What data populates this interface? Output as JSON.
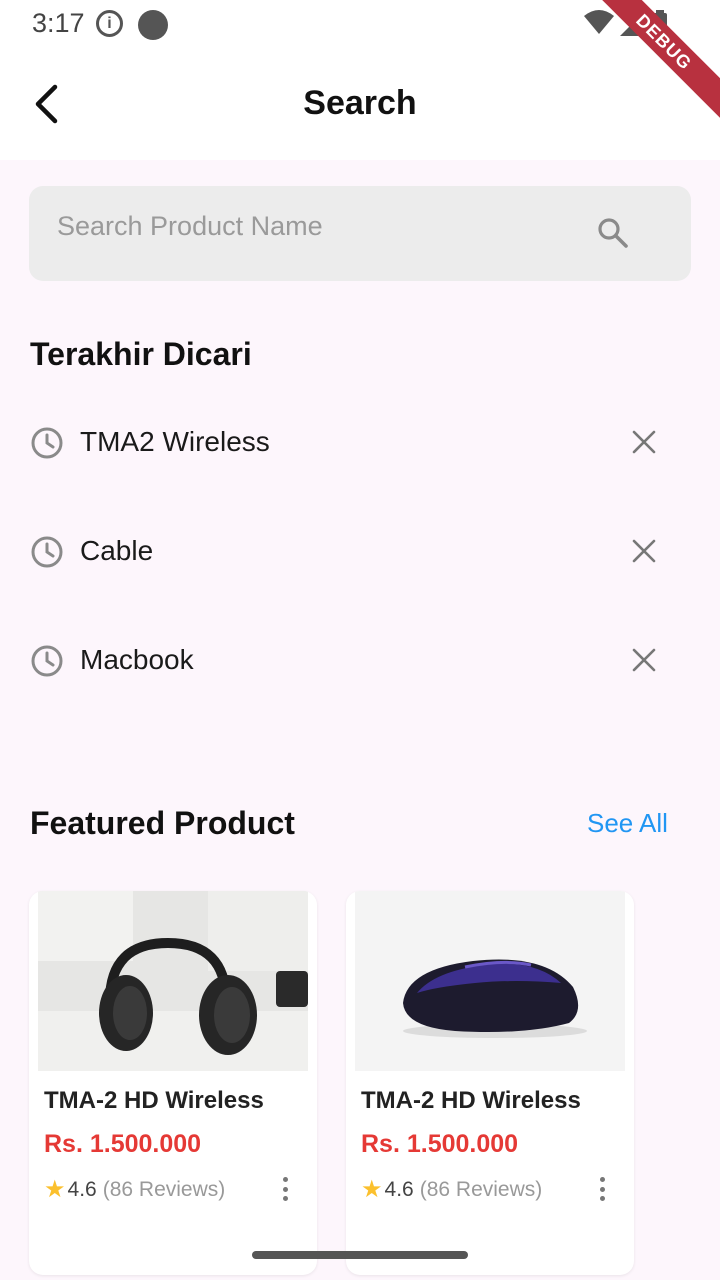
{
  "status_bar": {
    "time": "3:17",
    "info_glyph": "i"
  },
  "debug_banner": "DEBUG",
  "app_bar": {
    "title": "Search",
    "back_icon": "chevron-left-icon"
  },
  "search": {
    "placeholder": "Search Product Name",
    "value": "",
    "icon": "search-icon"
  },
  "recent": {
    "title": "Terakhir Dicari",
    "items": [
      {
        "label": "TMA2 Wireless"
      },
      {
        "label": "Cable"
      },
      {
        "label": "Macbook"
      }
    ]
  },
  "featured": {
    "title": "Featured Product",
    "see_all": "See All",
    "products": [
      {
        "name": "TMA-2 HD Wireless",
        "price": "Rs. 1.500.000",
        "rating": "4.6",
        "reviews": "(86 Reviews)",
        "image": "headphones"
      },
      {
        "name": "TMA-2 HD Wireless",
        "price": "Rs. 1.500.000",
        "rating": "4.6",
        "reviews": "(86 Reviews)",
        "image": "mouse"
      }
    ]
  },
  "colors": {
    "accent": "#2196f3",
    "price": "#e53935",
    "star": "#fbc02d",
    "background": "#fdf6fc",
    "search_bg": "#ececec"
  }
}
